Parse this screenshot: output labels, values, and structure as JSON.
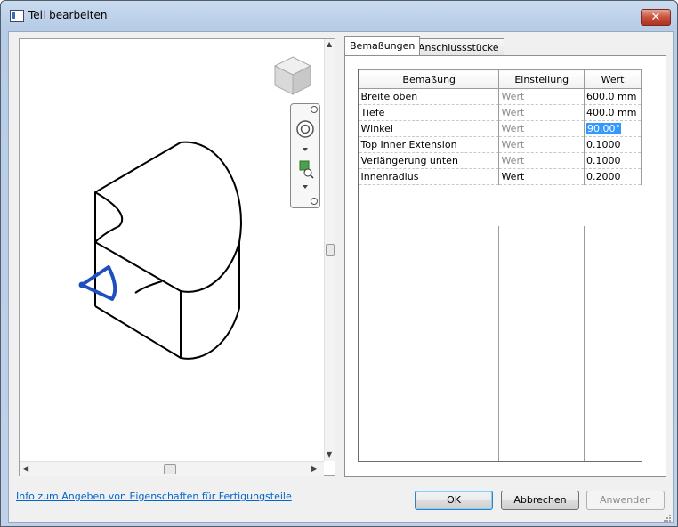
{
  "window": {
    "title": "Teil bearbeiten",
    "close_glyph": "✕"
  },
  "viewport": {
    "viewcube_icon": "viewcube-icon",
    "navbar_icons": [
      "close-small-icon",
      "steering-wheel-icon",
      "chevron-down-icon",
      "zoom-extents-icon",
      "chevron-down-icon",
      "minimize-icon"
    ]
  },
  "tabs": [
    {
      "label": "Bemaßungen",
      "active": true
    },
    {
      "label": "Anschlussstücke",
      "active": false
    }
  ],
  "grid": {
    "headers": [
      "Bemaßung",
      "Einstellung",
      "Wert"
    ],
    "rows": [
      {
        "name": "Breite oben",
        "setting": "Wert",
        "setting_gray": true,
        "value": "600.0 mm"
      },
      {
        "name": "Tiefe",
        "setting": "Wert",
        "setting_gray": true,
        "value": "400.0 mm"
      },
      {
        "name": "Winkel",
        "setting": "Wert",
        "setting_gray": true,
        "value": "90.00°",
        "selected": true
      },
      {
        "name": "Top Inner Extension",
        "setting": "Wert",
        "setting_gray": true,
        "value": "0.1000"
      },
      {
        "name": "Verlängerung unten",
        "setting": "Wert",
        "setting_gray": true,
        "value": "0.1000"
      },
      {
        "name": "Innenradius",
        "setting": "Wert",
        "setting_gray": false,
        "value": "0.2000"
      }
    ]
  },
  "footer": {
    "info_link": "Info zum Angeben von Eigenschaften für Fertigungsteile",
    "ok_label": "OK",
    "cancel_label": "Abbrechen",
    "apply_label": "Anwenden"
  },
  "colors": {
    "accent": "#3399ff",
    "selection_blue": "#1f4fbf",
    "link": "#0066cc"
  }
}
